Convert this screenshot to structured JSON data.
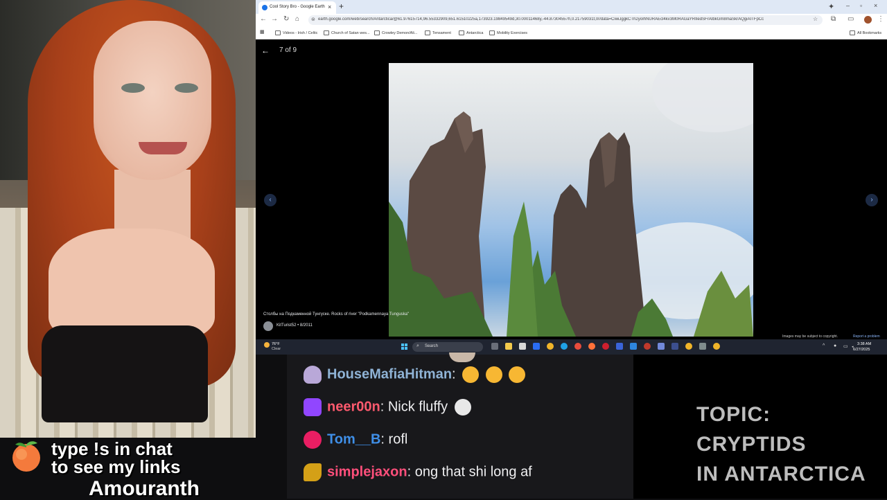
{
  "overlay": {
    "links_line1": "type !s in chat",
    "links_line2": "to see my links",
    "streamer_name": "Amouranth"
  },
  "browser": {
    "tab_title": "Cool Story Bro - Google Earth",
    "url": "earth.google.com/web/search/Antarctica/@61.97615714,96.55332909,651.61510225a,173923.19849549d,30.00011468y,-44.87304557h,0.21759031t,0r/data=CiwiJggkCTh2yoIhNURAEcl4kv3M0RAGaYRIIedSFrAIbkGm8maSkrAQgiAITFpCc",
    "bookmarks": [
      "Videos - Irish / Celtic",
      "Church of Satan wes...",
      "Crowley Demon/Ali...",
      "Tensament",
      "Antarctica",
      "Mobility Exercises"
    ],
    "all_bookmarks": "All Bookmarks",
    "icons": [
      "back-arrow-icon",
      "forward-arrow-icon",
      "reload-icon",
      "home-icon",
      "site-info-icon",
      "star-icon",
      "extensions-icon",
      "profile-icon"
    ]
  },
  "viewer": {
    "counter": "7 of 9",
    "caption": "Столбы на Подкаменной Тунгуске.  Rocks of river \"Podkamennaya Tunguska\"",
    "author": "KitTurist52 • 8/2011",
    "copyright": "Images may be subject to copyright.",
    "report": "Report a problem"
  },
  "taskbar": {
    "temperature": "76°F",
    "condition": "Clear",
    "search_label": "Search",
    "time": "3:38 AM",
    "date": "6/27/2025"
  },
  "chat": [
    {
      "user": "HouseMafiaHitman",
      "message": "",
      "color": "#8fb3d6",
      "badge_color": "#b9a8d8",
      "emotes": 3
    },
    {
      "user": "neer00n",
      "message": " Nick fluffy ",
      "color": "#ff5a6e",
      "badge_color": "#9146ff",
      "emotes": 1
    },
    {
      "user": "Tom__B",
      "message": " rofl",
      "color": "#3f8fe8",
      "badge_color": "#e91e63",
      "emotes": 0
    },
    {
      "user": "simplejaxon",
      "message": " ong that shi long af",
      "color": "#ff4f7b",
      "badge_color": "#d4a017",
      "emotes": 0
    }
  ],
  "topic": {
    "line1": "TOPIC:",
    "line2": "CRYPTIDS",
    "line3": "IN ANTARCTICA"
  }
}
